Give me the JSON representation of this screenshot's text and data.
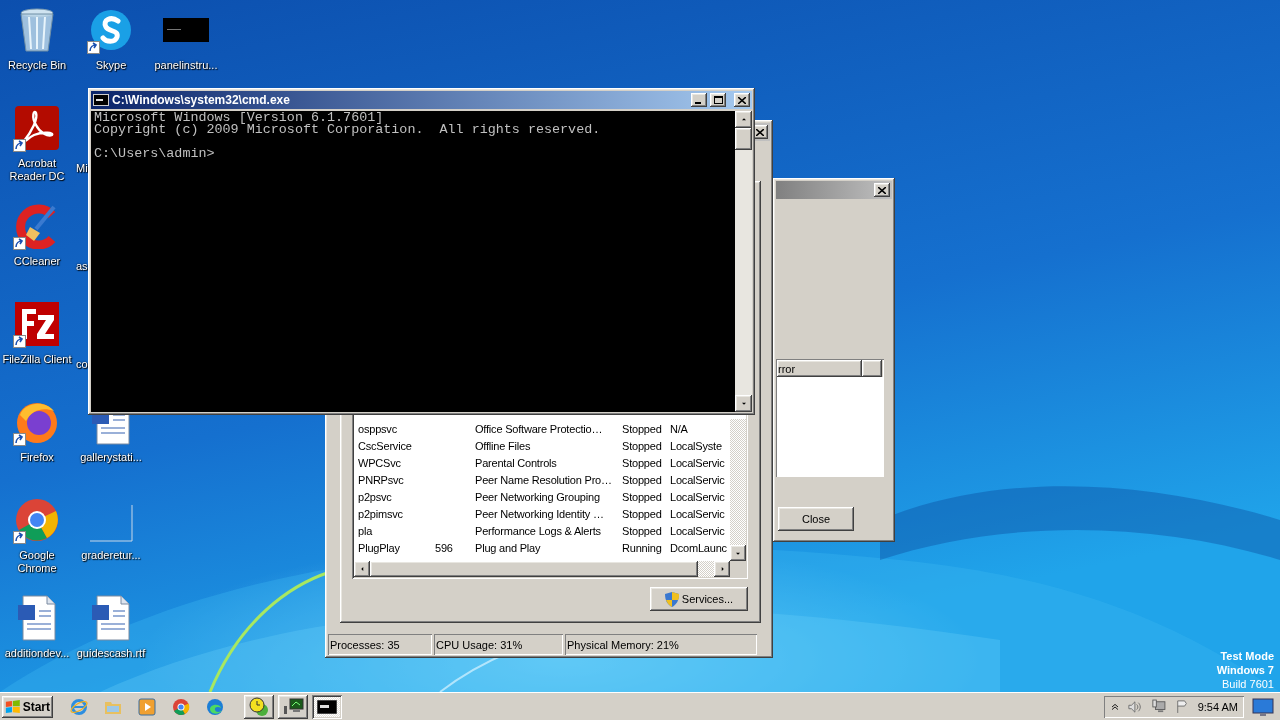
{
  "desktop_icons": [
    [
      {
        "label": "Recycle Bin",
        "kind": "recycle-bin",
        "shortcut": false
      },
      {
        "label": "Acrobat Reader DC",
        "kind": "acrobat",
        "shortcut": true
      },
      {
        "label": "CCleaner",
        "kind": "ccleaner",
        "shortcut": true
      },
      {
        "label": "FileZilla Client",
        "kind": "filezilla",
        "shortcut": true
      },
      {
        "label": "Firefox",
        "kind": "firefox",
        "shortcut": true
      },
      {
        "label": "Google Chrome",
        "kind": "chrome",
        "shortcut": true
      },
      {
        "label": "additiondev...",
        "kind": "word",
        "shortcut": false
      }
    ],
    [
      {
        "label": "Skype",
        "kind": "skype",
        "shortcut": true
      },
      {
        "label": "Mi",
        "kind": "covered"
      },
      {
        "label": "as",
        "kind": "covered"
      },
      {
        "label": "co",
        "kind": "covered"
      },
      {
        "label": "gallerystati...",
        "kind": "word",
        "shortcut": false
      },
      {
        "label": "graderetur...",
        "kind": "blank",
        "shortcut": false
      },
      {
        "label": "guidescash.rtf",
        "kind": "word",
        "shortcut": false
      }
    ],
    [
      {
        "label": "panelinstru...",
        "kind": "thumbnail",
        "shortcut": false
      }
    ]
  ],
  "services_dialog": {
    "active": false,
    "column_header": "rror",
    "button": "Close"
  },
  "task_manager": {
    "active": false,
    "rows": [
      {
        "column_1": "osppsvc",
        "column_3": "Office Software Protectio…",
        "column_4": "Stopped",
        "column_5": "N/A"
      },
      {
        "column_1": "CscService",
        "column_3": "Offline Files",
        "column_4": "Stopped",
        "column_5": "LocalSyste"
      },
      {
        "column_1": "WPCSvc",
        "column_3": "Parental Controls",
        "column_4": "Stopped",
        "column_5": "LocalServic"
      },
      {
        "column_1": "PNRPsvc",
        "column_3": "Peer Name Resolution Pro…",
        "column_4": "Stopped",
        "column_5": "LocalServic"
      },
      {
        "column_1": "p2psvc",
        "column_3": "Peer Networking Grouping",
        "column_4": "Stopped",
        "column_5": "LocalServic"
      },
      {
        "column_1": "p2pimsvc",
        "column_3": "Peer Networking Identity …",
        "column_4": "Stopped",
        "column_5": "LocalServic"
      },
      {
        "column_1": "pla",
        "column_3": "Performance Logs & Alerts",
        "column_4": "Stopped",
        "column_5": "LocalServic"
      },
      {
        "column_1": "PlugPlay",
        "column_2": "596",
        "column_3": "Plug and Play",
        "column_4": "Running",
        "column_5": "DcomLaunc"
      }
    ],
    "services_button": "Services...",
    "status_bar": [
      "Processes: 35",
      "CPU Usage: 31%",
      "Physical Memory: 21%"
    ]
  },
  "console": {
    "active": true,
    "title": "C:\\Windows\\system32\\cmd.exe",
    "blocks": [
      [
        "Microsoft Windows [Version 6.1.7601]",
        "Copyright (c) 2009 Microsoft Corporation.  All rights reserved."
      ],
      [
        "C:\\Users\\admin>"
      ]
    ]
  },
  "desktop_notice": [
    {
      "text": "Test Mode",
      "emphasis": true
    },
    {
      "text": "Windows 7",
      "emphasis": true
    },
    {
      "text": "Build 7601",
      "emphasis": false
    }
  ],
  "taskbar": {
    "start": "Start",
    "pinned": [
      {
        "kind": "ie"
      },
      {
        "kind": "folder"
      },
      {
        "kind": "media"
      },
      {
        "kind": "chrome"
      },
      {
        "kind": "edge"
      }
    ],
    "tasks": [
      {
        "kind": "clock-app",
        "selected": false
      },
      {
        "kind": "network-app",
        "selected": false
      },
      {
        "kind": "console",
        "selected": true
      }
    ],
    "clock": "9:54 AM"
  }
}
